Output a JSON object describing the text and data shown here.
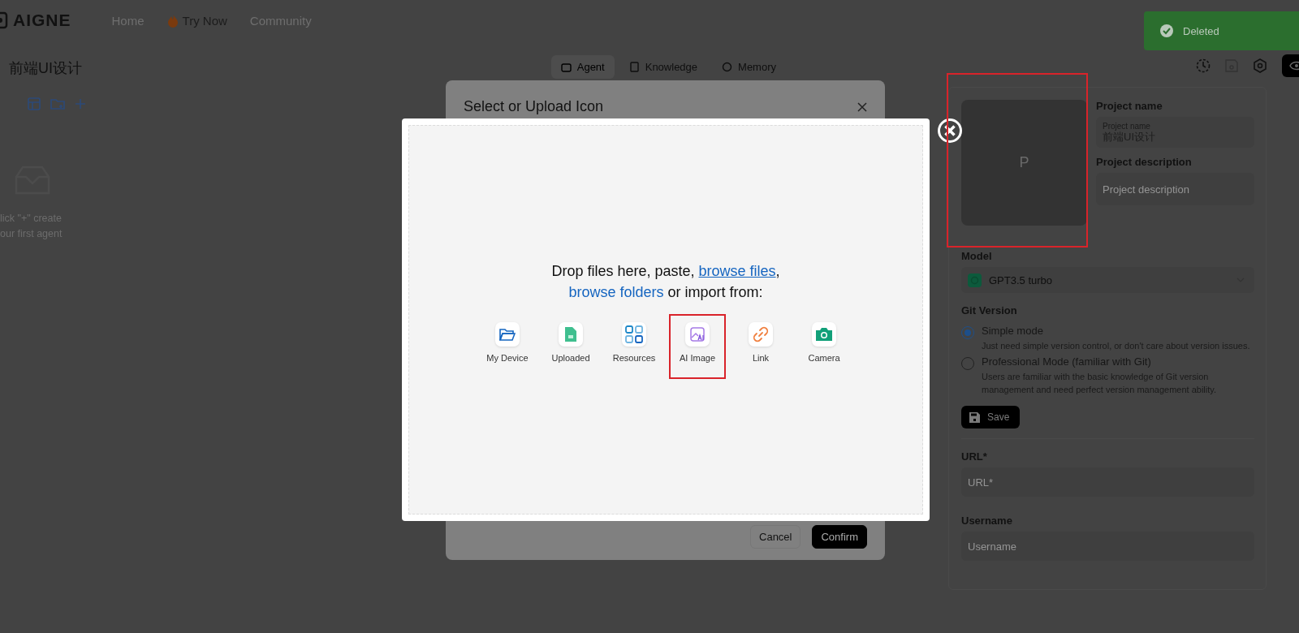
{
  "header": {
    "logo": "AIGNE",
    "nav": [
      {
        "label": "Home",
        "kind": "link"
      },
      {
        "label": "Try Now",
        "kind": "featured"
      },
      {
        "label": "Community",
        "kind": "link"
      }
    ]
  },
  "toast": {
    "message": "Deleted"
  },
  "sidebar": {
    "project_title": "前端UI设计",
    "empty_lines": [
      "lick \"+\" create",
      "our first agent"
    ]
  },
  "tabs": [
    {
      "label": "Agent",
      "selected": true
    },
    {
      "label": "Knowledge",
      "selected": false
    },
    {
      "label": "Memory",
      "selected": false
    }
  ],
  "panel": {
    "avatar": {
      "letter": "P",
      "highlighted": true
    },
    "project_name": {
      "label": "Project name",
      "floating_label": "Project name",
      "value": "前端UI设计"
    },
    "project_description": {
      "label": "Project description",
      "placeholder": "Project description"
    },
    "model": {
      "label": "Model",
      "value": "GPT3.5 turbo"
    },
    "git_version": {
      "label": "Git Version",
      "options": [
        {
          "title": "Simple mode",
          "description": "Just need simple version control, or don't care about version issues.",
          "selected": true
        },
        {
          "title": "Professional Mode (familiar with Git)",
          "description": "Users are familiar with the basic knowledge of Git version management and need perfect version management ability.",
          "selected": false
        }
      ]
    },
    "save_button": "Save",
    "url": {
      "label": "URL*",
      "placeholder": "URL*"
    },
    "username": {
      "label": "Username",
      "placeholder": "Username"
    }
  },
  "dialog": {
    "title": "Select or Upload Icon",
    "buttons": [
      {
        "label": "Cancel",
        "kind": "secondary"
      },
      {
        "label": "Confirm",
        "kind": "primary"
      }
    ]
  },
  "uploader": {
    "prompt": [
      {
        "text": "Drop files here, paste, ",
        "kind": "text"
      },
      {
        "text": "browse files",
        "kind": "link"
      },
      {
        "text": ", ",
        "kind": "text"
      },
      {
        "text": "browse folders",
        "kind": "plain-link"
      },
      {
        "text": " or import from:",
        "kind": "text"
      }
    ],
    "sources": [
      {
        "label": "My Device",
        "kind": "device",
        "highlighted": false
      },
      {
        "label": "Uploaded",
        "kind": "uploaded",
        "highlighted": false
      },
      {
        "label": "Resources",
        "kind": "resources",
        "highlighted": false
      },
      {
        "label": "AI Image",
        "kind": "ai",
        "highlighted": true
      },
      {
        "label": "Link",
        "kind": "link",
        "highlighted": false
      },
      {
        "label": "Camera",
        "kind": "camera",
        "highlighted": false
      }
    ]
  }
}
